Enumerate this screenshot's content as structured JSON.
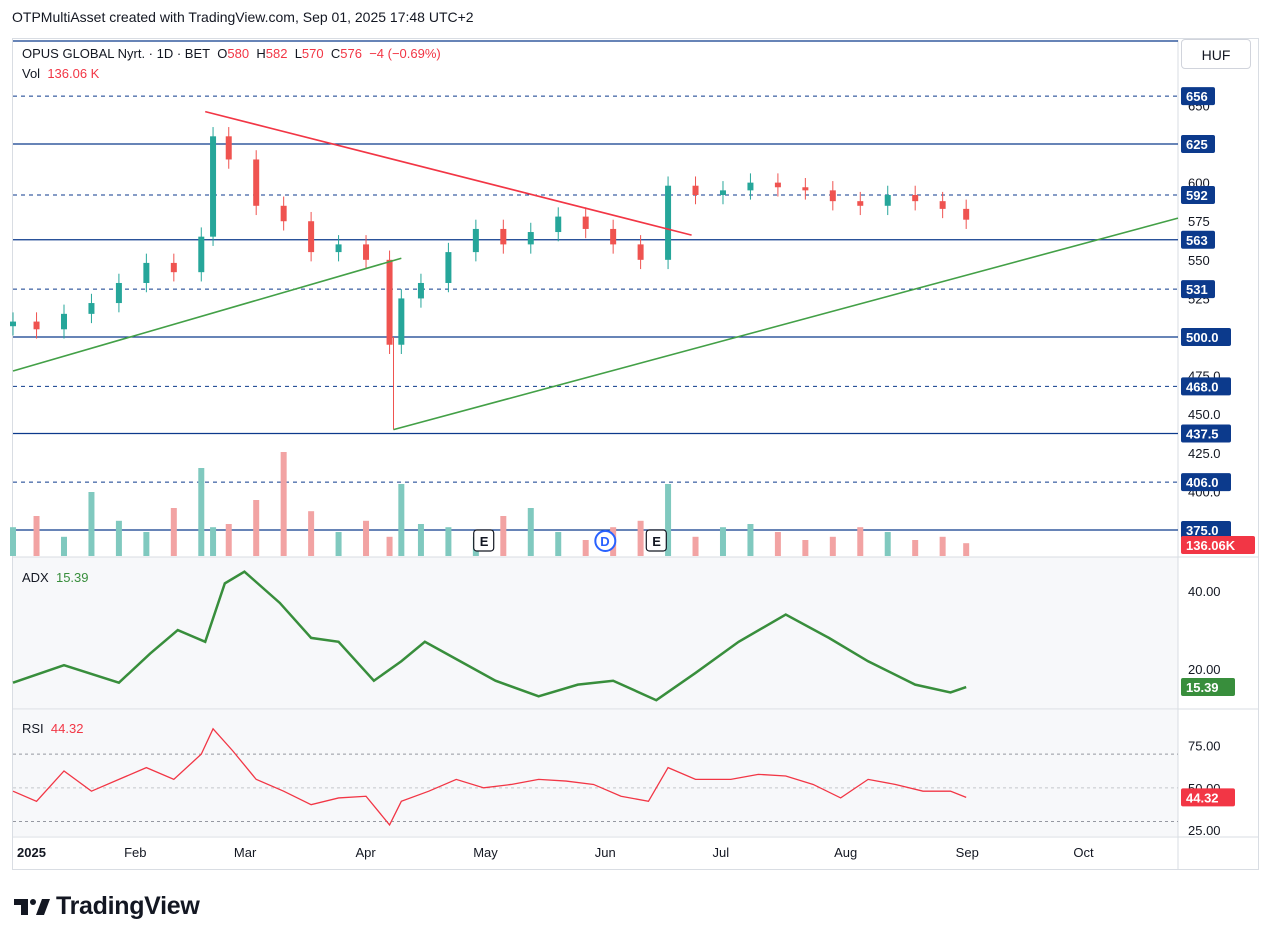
{
  "header": {
    "title": "OTPMultiAsset created with TradingView.com, Sep 01, 2025 17:48 UTC+2"
  },
  "legend": {
    "symbol": "OPUS GLOBAL Nyrt. · 1D · BET",
    "o_label": "O",
    "o_value": "580",
    "h_label": "H",
    "h_value": "582",
    "l_label": "L",
    "l_value": "570",
    "c_label": "C",
    "c_value": "576",
    "change": "−4 (−0.69%)",
    "vol_label": "Vol",
    "vol_value": "136.06 K"
  },
  "currency": "HUF",
  "price_axis": {
    "ticks": [
      "650",
      "625",
      "600",
      "575",
      "550",
      "525",
      "500.0",
      "475.0",
      "450.0",
      "425.0",
      "400.0",
      "375.0"
    ],
    "level_labels": [
      "656",
      "625",
      "592",
      "563",
      "531",
      "500.0",
      "468.0",
      "437.5",
      "406.0",
      "375.0"
    ],
    "volume_label": "136.06K"
  },
  "adx": {
    "label": "ADX",
    "value": "15.39",
    "ticks": [
      "40.00",
      "20.00"
    ]
  },
  "rsi": {
    "label": "RSI",
    "value": "44.32",
    "ticks": [
      "75.00",
      "50.00",
      "25.00"
    ]
  },
  "time_axis": [
    "2025",
    "Feb",
    "Mar",
    "Apr",
    "May",
    "Jun",
    "Jul",
    "Aug",
    "Sep",
    "Oct"
  ],
  "event_markers": [
    "E",
    "D",
    "E"
  ],
  "brand": "TradingView",
  "colors": {
    "up": "#26a69a",
    "down": "#ef5350",
    "level": "#0c3a8c",
    "adx": "#388e3c",
    "rsi": "#f23645",
    "resistance": "#f23645",
    "support": "#43a047"
  },
  "chart_data": [
    {
      "type": "candlestick",
      "title": "OPUS GLOBAL Nyrt. · 1D · BET",
      "ylim": [
        375,
        660
      ],
      "x_range": [
        "2025-01-01",
        "2025-10-25"
      ],
      "close_series": [
        [
          "2025-01-01",
          510
        ],
        [
          "2025-01-07",
          505
        ],
        [
          "2025-01-14",
          515
        ],
        [
          "2025-01-21",
          522
        ],
        [
          "2025-01-28",
          535
        ],
        [
          "2025-02-04",
          548
        ],
        [
          "2025-02-11",
          542
        ],
        [
          "2025-02-18",
          565
        ],
        [
          "2025-02-21",
          630
        ],
        [
          "2025-02-25",
          615
        ],
        [
          "2025-03-04",
          585
        ],
        [
          "2025-03-11",
          575
        ],
        [
          "2025-03-18",
          555
        ],
        [
          "2025-03-25",
          560
        ],
        [
          "2025-04-01",
          550
        ],
        [
          "2025-04-07",
          495
        ],
        [
          "2025-04-10",
          525
        ],
        [
          "2025-04-15",
          535
        ],
        [
          "2025-04-22",
          555
        ],
        [
          "2025-04-29",
          570
        ],
        [
          "2025-05-06",
          560
        ],
        [
          "2025-05-13",
          568
        ],
        [
          "2025-05-20",
          578
        ],
        [
          "2025-05-27",
          570
        ],
        [
          "2025-06-03",
          560
        ],
        [
          "2025-06-10",
          550
        ],
        [
          "2025-06-17",
          598
        ],
        [
          "2025-06-24",
          592
        ],
        [
          "2025-07-01",
          595
        ],
        [
          "2025-07-08",
          600
        ],
        [
          "2025-07-15",
          597
        ],
        [
          "2025-07-22",
          595
        ],
        [
          "2025-07-29",
          588
        ],
        [
          "2025-08-05",
          585
        ],
        [
          "2025-08-12",
          592
        ],
        [
          "2025-08-19",
          588
        ],
        [
          "2025-08-26",
          583
        ],
        [
          "2025-09-01",
          576
        ]
      ],
      "horizontal_levels": [
        656,
        625,
        592,
        563,
        531,
        500.0,
        468.0,
        437.5,
        406.0,
        375.0
      ],
      "trendlines": [
        {
          "from": [
            "2025-02-19",
            646
          ],
          "to": [
            "2025-06-23",
            566
          ]
        },
        {
          "from": [
            "2025-01-01",
            478
          ],
          "to": [
            "2025-04-10",
            551
          ]
        },
        {
          "from": [
            "2025-04-08",
            440
          ],
          "to": [
            "2025-10-25",
            577
          ]
        }
      ],
      "volume_last": "136.06K"
    },
    {
      "type": "line",
      "series": [
        {
          "name": "ADX",
          "values": [
            [
              "2025-01-01",
              16.5
            ],
            [
              "2025-01-14",
              21
            ],
            [
              "2025-01-28",
              16.5
            ],
            [
              "2025-02-05",
              24
            ],
            [
              "2025-02-12",
              30
            ],
            [
              "2025-02-19",
              27
            ],
            [
              "2025-02-24",
              42
            ],
            [
              "2025-03-01",
              45
            ],
            [
              "2025-03-10",
              37
            ],
            [
              "2025-03-18",
              28
            ],
            [
              "2025-03-25",
              27
            ],
            [
              "2025-04-03",
              17
            ],
            [
              "2025-04-10",
              22
            ],
            [
              "2025-04-16",
              27
            ],
            [
              "2025-04-25",
              22
            ],
            [
              "2025-05-04",
              17
            ],
            [
              "2025-05-15",
              13
            ],
            [
              "2025-05-25",
              16
            ],
            [
              "2025-06-03",
              17
            ],
            [
              "2025-06-14",
              12
            ],
            [
              "2025-06-24",
              19
            ],
            [
              "2025-07-05",
              27
            ],
            [
              "2025-07-17",
              34
            ],
            [
              "2025-07-28",
              28
            ],
            [
              "2025-08-07",
              22
            ],
            [
              "2025-08-19",
              16
            ],
            [
              "2025-08-28",
              14
            ],
            [
              "2025-09-01",
              15.39
            ]
          ]
        }
      ],
      "ylim": [
        10,
        48
      ]
    },
    {
      "type": "line",
      "series": [
        {
          "name": "RSI",
          "values": [
            [
              "2025-01-01",
              48
            ],
            [
              "2025-01-07",
              42
            ],
            [
              "2025-01-14",
              60
            ],
            [
              "2025-01-21",
              48
            ],
            [
              "2025-01-28",
              55
            ],
            [
              "2025-02-04",
              62
            ],
            [
              "2025-02-11",
              55
            ],
            [
              "2025-02-18",
              70
            ],
            [
              "2025-02-21",
              85
            ],
            [
              "2025-02-26",
              72
            ],
            [
              "2025-03-04",
              55
            ],
            [
              "2025-03-11",
              48
            ],
            [
              "2025-03-18",
              40
            ],
            [
              "2025-03-25",
              44
            ],
            [
              "2025-04-01",
              45
            ],
            [
              "2025-04-07",
              28
            ],
            [
              "2025-04-10",
              42
            ],
            [
              "2025-04-17",
              48
            ],
            [
              "2025-04-24",
              55
            ],
            [
              "2025-05-01",
              50
            ],
            [
              "2025-05-08",
              52
            ],
            [
              "2025-05-15",
              55
            ],
            [
              "2025-05-22",
              54
            ],
            [
              "2025-05-29",
              52
            ],
            [
              "2025-06-05",
              45
            ],
            [
              "2025-06-12",
              42
            ],
            [
              "2025-06-17",
              62
            ],
            [
              "2025-06-24",
              55
            ],
            [
              "2025-07-03",
              55
            ],
            [
              "2025-07-10",
              58
            ],
            [
              "2025-07-17",
              57
            ],
            [
              "2025-07-24",
              52
            ],
            [
              "2025-07-31",
              44
            ],
            [
              "2025-08-07",
              55
            ],
            [
              "2025-08-14",
              52
            ],
            [
              "2025-08-21",
              48
            ],
            [
              "2025-08-28",
              48
            ],
            [
              "2025-09-01",
              44.32
            ]
          ]
        }
      ],
      "ylim": [
        22,
        95
      ],
      "bands": [
        30,
        70
      ]
    }
  ]
}
